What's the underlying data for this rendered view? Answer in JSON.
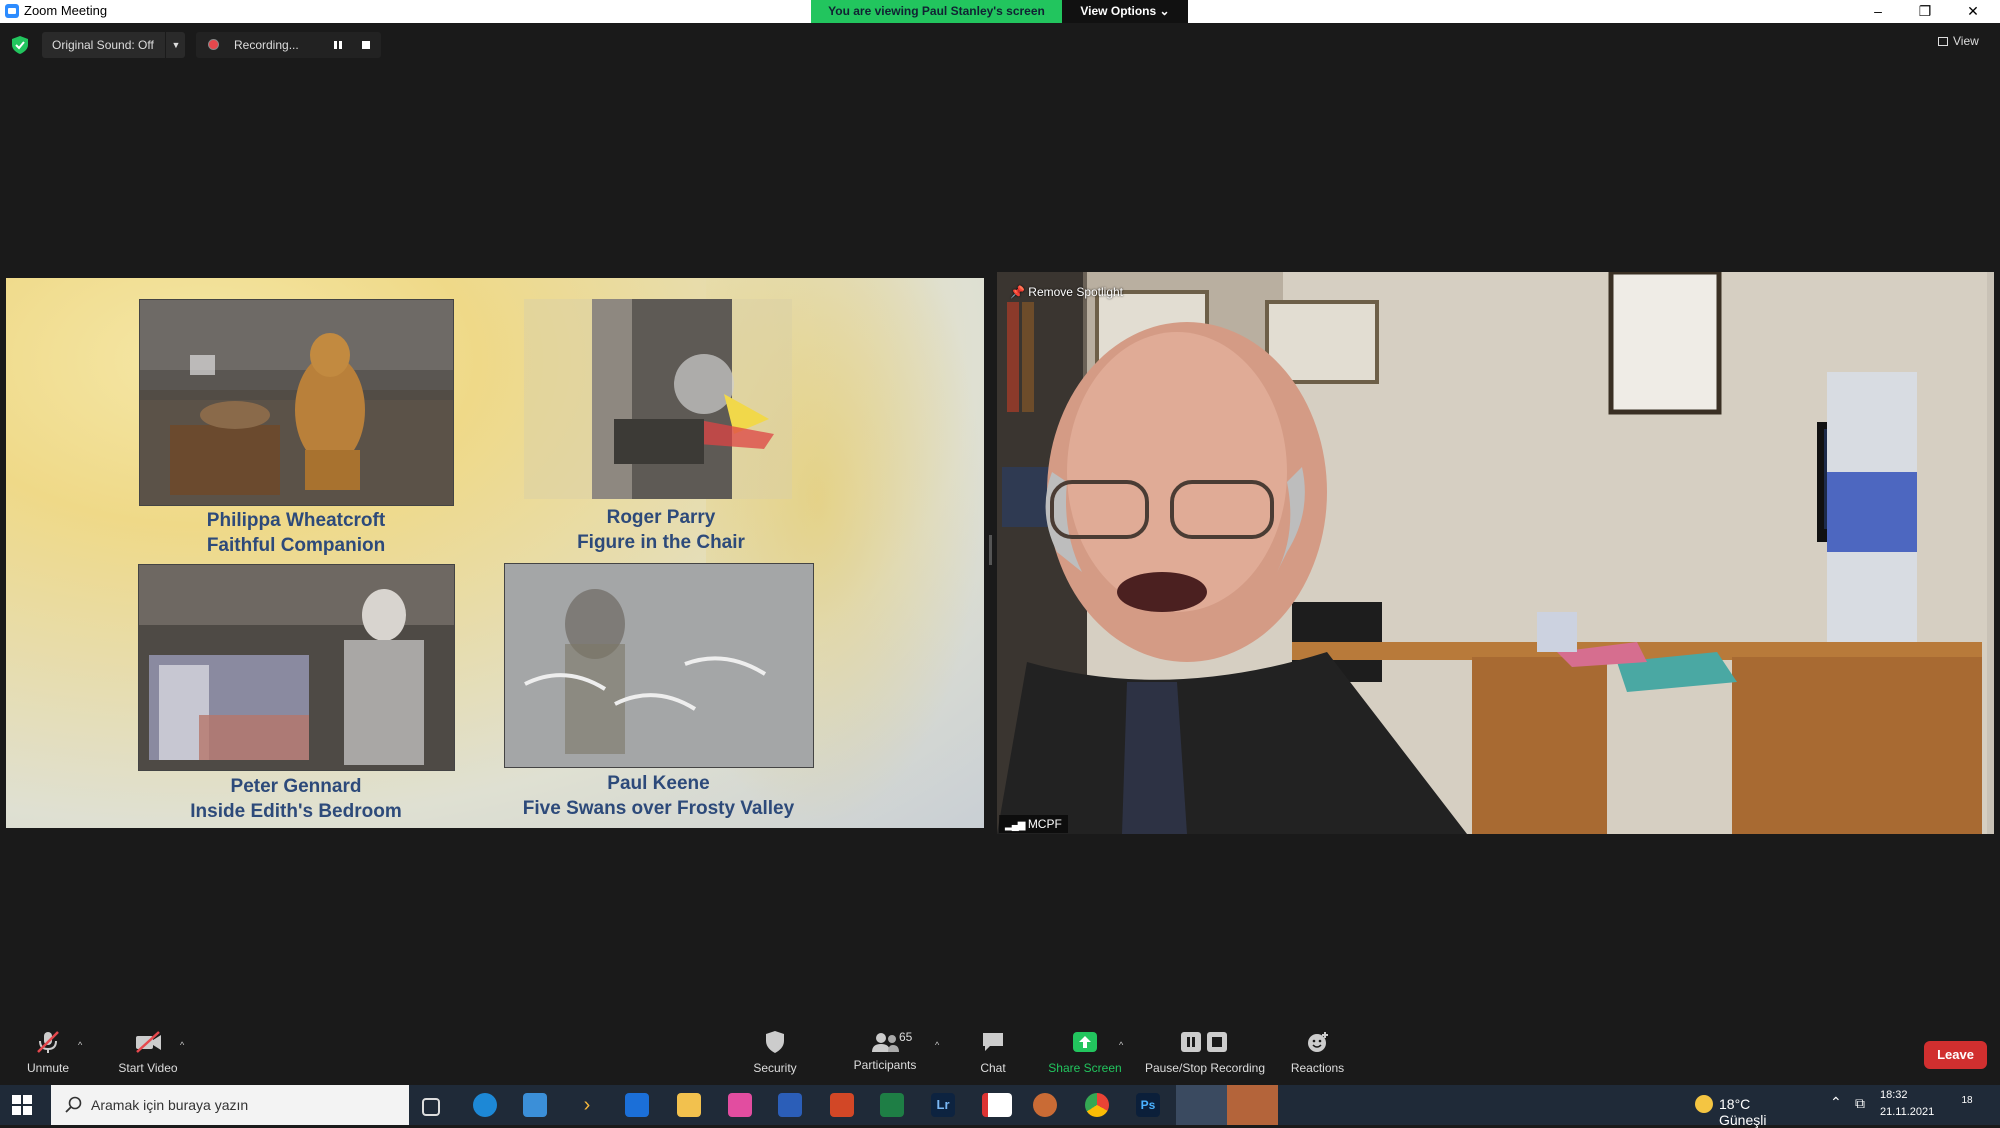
{
  "window": {
    "title": "Zoom Meeting"
  },
  "banner": {
    "viewing_text": "You are viewing Paul Stanley's screen",
    "view_options": "View Options"
  },
  "window_controls": {
    "minimize": "–",
    "restore": "❐",
    "close": "✕"
  },
  "top_bar": {
    "original_sound": "Original Sound: Off",
    "recording": "Recording...",
    "view": "View"
  },
  "shared_screen": {
    "entries": [
      {
        "author": "Philippa Wheatcroft",
        "title": "Faithful Companion"
      },
      {
        "author": "Roger Parry",
        "title": "Figure in the Chair"
      },
      {
        "author": "Peter Gennard",
        "title": "Inside Edith's Bedroom"
      },
      {
        "author": "Paul Keene",
        "title": "Five Swans over Frosty Valley"
      }
    ]
  },
  "speaker": {
    "remove_spotlight": "Remove Spotlight",
    "name": "MCPF"
  },
  "toolbar": {
    "unmute": "Unmute",
    "start_video": "Start Video",
    "security": "Security",
    "participants": "Participants",
    "participants_count": "65",
    "chat": "Chat",
    "share_screen": "Share Screen",
    "pause_stop_recording": "Pause/Stop Recording",
    "reactions": "Reactions",
    "leave": "Leave"
  },
  "taskbar": {
    "search_placeholder": "Aramak için buraya yazın",
    "weather": "18°C  Güneşli",
    "time": "18:32",
    "date": "21.11.2021",
    "notifications": "18"
  },
  "colors": {
    "share_green": "#22c55e",
    "leave_red": "#d12f2f",
    "caption_blue": "#2d4a7a"
  }
}
